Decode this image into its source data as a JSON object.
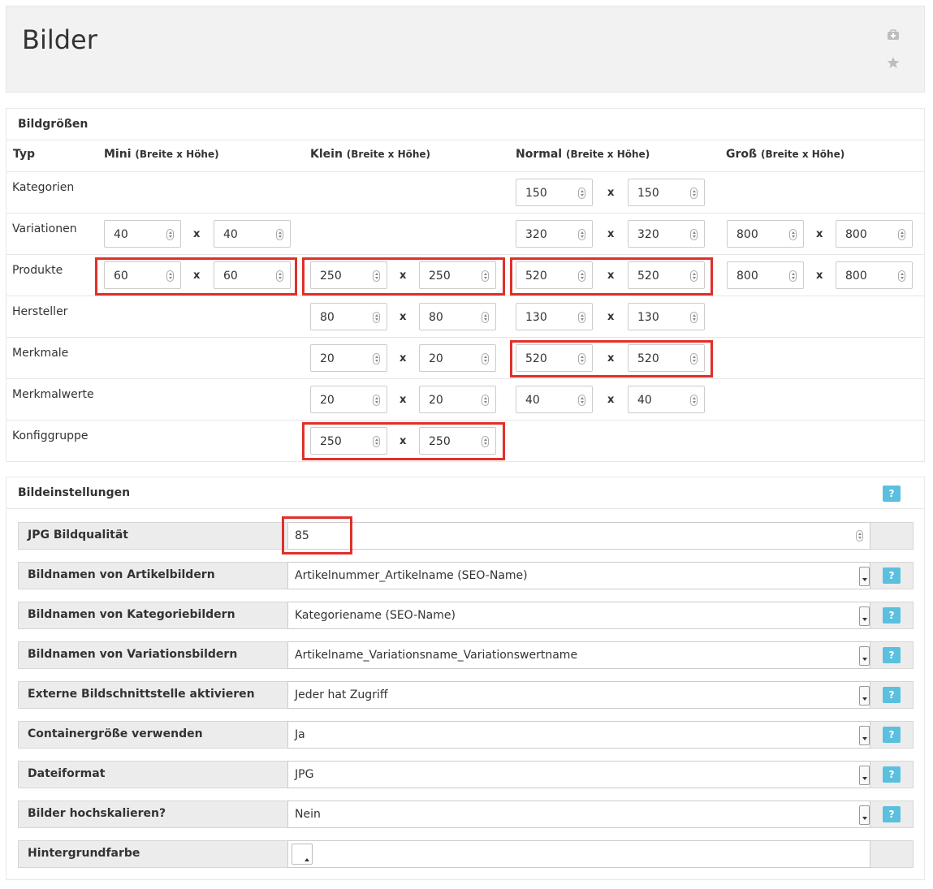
{
  "header": {
    "title": "Bilder",
    "icons": [
      "medkit-icon",
      "star-icon"
    ]
  },
  "sizes": {
    "title": "Bildgrößen",
    "columns": {
      "typ": "Typ",
      "mini": "Mini",
      "klein": "Klein",
      "normal": "Normal",
      "gross": "Groß",
      "dim_hint": "(Breite x Höhe)"
    },
    "separator": "x",
    "rows": {
      "kategorien": {
        "label": "Kategorien",
        "normal_w": "150",
        "normal_h": "150"
      },
      "variationen": {
        "label": "Variationen",
        "mini_w": "40",
        "mini_h": "40",
        "normal_w": "320",
        "normal_h": "320",
        "gross_w": "800",
        "gross_h": "800"
      },
      "produkte": {
        "label": "Produkte",
        "mini_w": "60",
        "mini_h": "60",
        "klein_w": "250",
        "klein_h": "250",
        "normal_w": "520",
        "normal_h": "520",
        "gross_w": "800",
        "gross_h": "800"
      },
      "hersteller": {
        "label": "Hersteller",
        "klein_w": "80",
        "klein_h": "80",
        "normal_w": "130",
        "normal_h": "130"
      },
      "merkmale": {
        "label": "Merkmale",
        "klein_w": "20",
        "klein_h": "20",
        "normal_w": "520",
        "normal_h": "520"
      },
      "merkmalwerte": {
        "label": "Merkmalwerte",
        "klein_w": "20",
        "klein_h": "20",
        "normal_w": "40",
        "normal_h": "40"
      },
      "konfiggruppe": {
        "label": "Konfiggruppe",
        "klein_w": "250",
        "klein_h": "250"
      }
    }
  },
  "settings": {
    "title": "Bildeinstellungen",
    "help": "?",
    "jpg_quality": {
      "label": "JPG Bildqualität",
      "value": "85"
    },
    "artikel_names": {
      "label": "Bildnamen von Artikelbildern",
      "value": "Artikelnummer_Artikelname (SEO-Name)"
    },
    "kategorie_names": {
      "label": "Bildnamen von Kategoriebildern",
      "value": "Kategoriename (SEO-Name)"
    },
    "variation_names": {
      "label": "Bildnamen von Variationsbildern",
      "value": "Artikelname_Variationsname_Variationswertname"
    },
    "external_api": {
      "label": "Externe Bildschnittstelle aktivieren",
      "value": "Jeder hat Zugriff"
    },
    "container_size": {
      "label": "Containergröße verwenden",
      "value": "Ja"
    },
    "file_format": {
      "label": "Dateiformat",
      "value": "JPG"
    },
    "upscale": {
      "label": "Bilder hochskalieren?",
      "value": "Nein"
    },
    "background_color": {
      "label": "Hintergrundfarbe",
      "value": "#ffffff"
    }
  },
  "colors": {
    "highlight": "#e0302a",
    "help_button": "#5bc0de",
    "header_bg": "#f2f2f2",
    "row_label_bg": "#ececec"
  }
}
